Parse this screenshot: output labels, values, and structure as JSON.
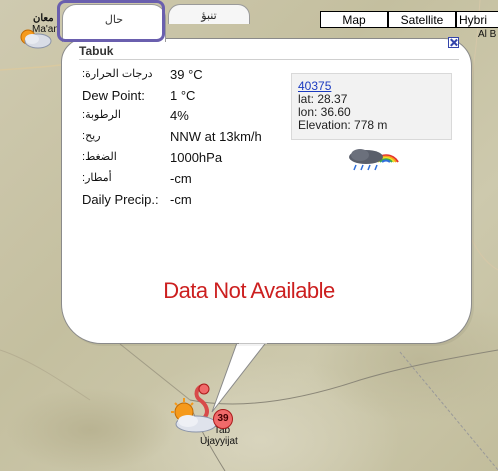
{
  "tabs": {
    "now_label": "حال",
    "forecast_label": "تنبؤ"
  },
  "map_types": {
    "map": "Map",
    "satellite": "Satellite",
    "hybrid": "Hybri"
  },
  "station": {
    "name": "Tabuk",
    "rows": [
      {
        "label": ":درجات الحرارة",
        "value": "39 °C"
      },
      {
        "label": "Dew Point:",
        "value": "1 °C"
      },
      {
        "label": ":الرطوبة",
        "value": "4%"
      },
      {
        "label": ":ريح",
        "value": "NNW at 13km/h"
      },
      {
        "label": ":الضغط",
        "value": "1000hPa"
      },
      {
        "label": ":أمطار",
        "value": "-cm"
      },
      {
        "label": "Daily Precip.:",
        "value": "-cm"
      }
    ],
    "id": "40375",
    "lat": "lat: 28.37",
    "lon": "lon: 36.60",
    "elevation": "Elevation: 778 m"
  },
  "message": "Data Not Available",
  "map_labels": {
    "top_left_city": "معان",
    "top_left_city_latin": "Ma'an",
    "top_right": "Al B",
    "bottom_city": "Ujayyijat",
    "bottom_city_partial": "Tab"
  },
  "marker_temp": "39",
  "colors": {
    "no_data": "#cc1f1f",
    "link": "#1a3ac0",
    "tab_highlight": "#6a5fae"
  }
}
